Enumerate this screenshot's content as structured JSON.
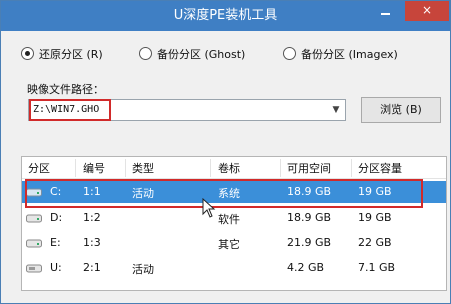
{
  "window": {
    "title": "U深度PE装机工具"
  },
  "titlebar": {
    "minimize_label": "",
    "close_label": "×"
  },
  "mode": {
    "options": [
      {
        "label": "还原分区 (R)",
        "selected": true
      },
      {
        "label": "备份分区 (Ghost)",
        "selected": false
      },
      {
        "label": "备份分区 (Imagex)",
        "selected": false
      }
    ]
  },
  "image_path": {
    "label": "映像文件路径：",
    "value": "Z:\\WIN7.GHO",
    "browse_label": "浏览 (B)"
  },
  "partitions": {
    "headers": [
      "分区",
      "编号",
      "类型",
      "卷标",
      "可用空间",
      "分区容量"
    ],
    "rows": [
      {
        "drive": "C:",
        "number": "1:1",
        "type": "活动",
        "label": "系统",
        "free": "18.9 GB",
        "capacity": "19 GB",
        "selected": true
      },
      {
        "drive": "D:",
        "number": "1:2",
        "type": "",
        "label": "软件",
        "free": "18.9 GB",
        "capacity": "19 GB",
        "selected": false
      },
      {
        "drive": "E:",
        "number": "1:3",
        "type": "",
        "label": "其它",
        "free": "21.9 GB",
        "capacity": "22 GB",
        "selected": false
      },
      {
        "drive": "U:",
        "number": "2:1",
        "type": "活动",
        "label": "",
        "free": "4.2 GB",
        "capacity": "7.1 GB",
        "selected": false
      }
    ]
  },
  "colors": {
    "title_bar": "#3f7fc4",
    "selection": "#3b8fd9",
    "highlight_box": "#d12a2a"
  },
  "icons": {
    "drive": "hard-drive-icon",
    "usb": "usb-drive-icon"
  }
}
